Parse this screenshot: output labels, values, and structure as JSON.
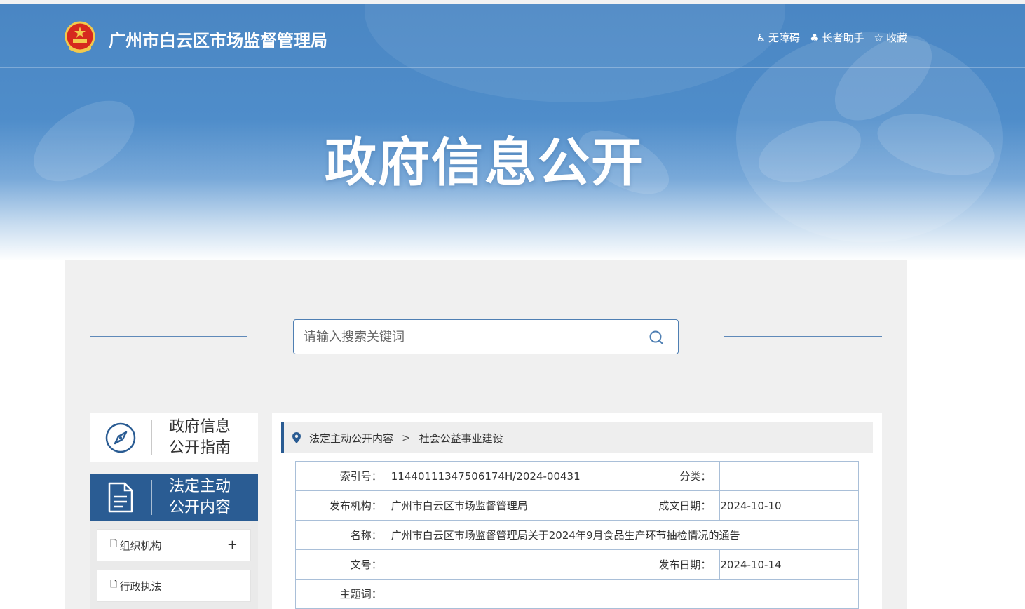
{
  "header": {
    "site_title": "广州市白云区市场监督管理局",
    "links": [
      {
        "icon": "wheelchair-icon",
        "label": "无障碍"
      },
      {
        "icon": "elder-helper-icon",
        "label": "长者助手"
      },
      {
        "icon": "star-icon",
        "label": "收藏"
      }
    ]
  },
  "hero": {
    "title": "政府信息公开"
  },
  "search": {
    "placeholder": "请输入搜索关键词"
  },
  "sidebar": {
    "cards": [
      {
        "icon": "compass-icon",
        "line1": "政府信息",
        "line2": "公开指南",
        "active": false
      },
      {
        "icon": "document-icon",
        "line1": "法定主动",
        "line2": "公开内容",
        "active": true
      }
    ],
    "items": [
      {
        "label": "组织机构",
        "expand": "+"
      },
      {
        "label": "行政执法"
      }
    ]
  },
  "breadcrumb": {
    "items": [
      "法定主动公开内容",
      "社会公益事业建设"
    ],
    "separator": ">"
  },
  "info_table": {
    "index_label": "索引号：",
    "index_value": "11440111347506174H/2024-00431",
    "category_label": "分类：",
    "category_value": "",
    "publisher_label": "发布机构：",
    "publisher_value": "广州市白云区市场监督管理局",
    "written_date_label": "成文日期：",
    "written_date_value": "2024-10-10",
    "name_label": "名称：",
    "name_value": "广州市白云区市场监督管理局关于2024年9月食品生产环节抽检情况的通告",
    "doc_no_label": "文号：",
    "doc_no_value": "",
    "publish_date_label": "发布日期：",
    "publish_date_value": "2024-10-14",
    "subject_label": "主题词：",
    "subject_value": ""
  },
  "colors": {
    "primary": "#2a5c93",
    "banner": "#4f8dca",
    "content_bg": "#f0f0f0",
    "table_border": "#a9bfd8"
  }
}
